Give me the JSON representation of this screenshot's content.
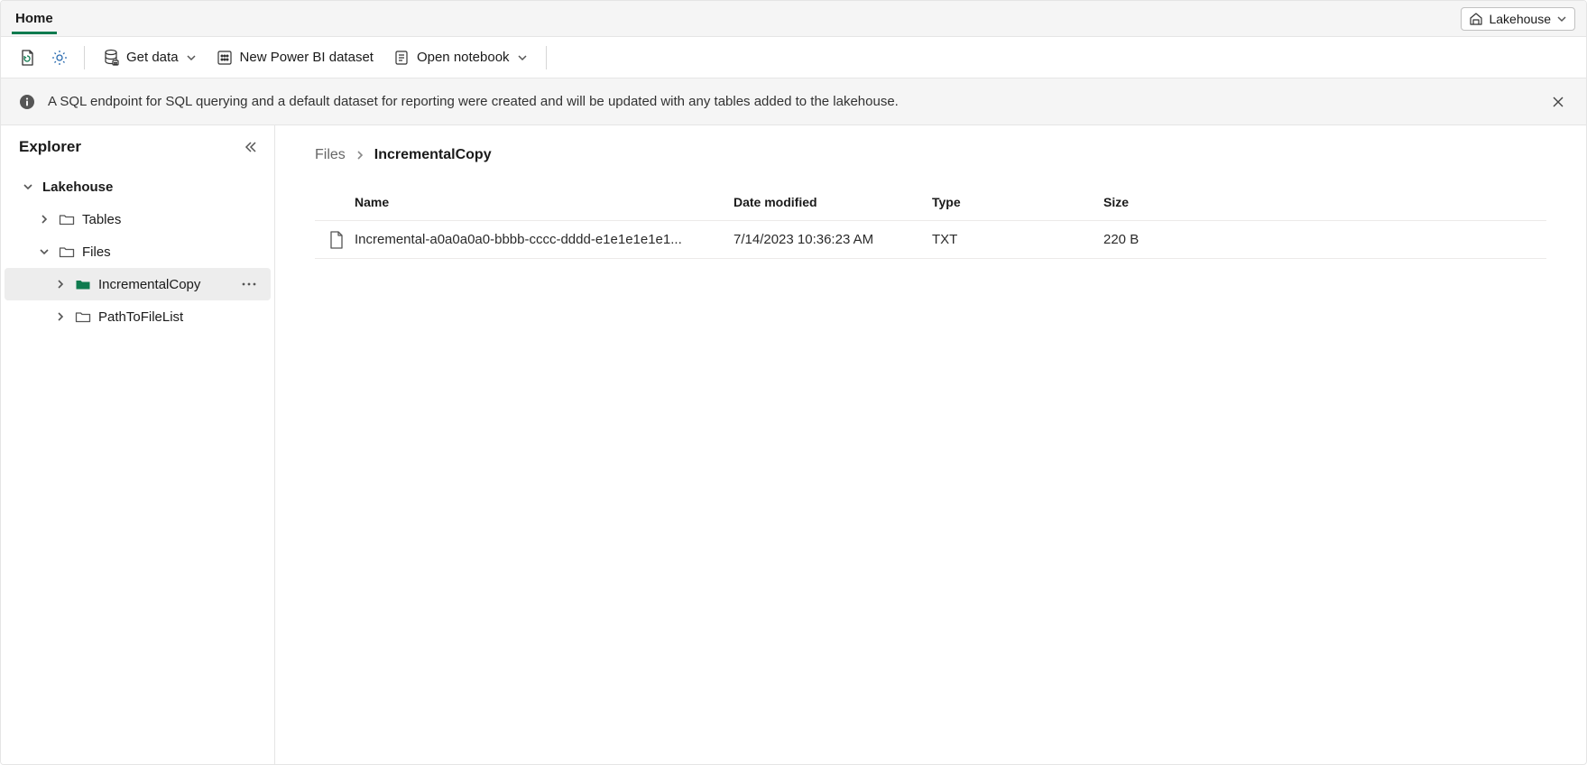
{
  "header": {
    "tab_home": "Home",
    "mode_label": "Lakehouse"
  },
  "toolbar": {
    "get_data_label": "Get data",
    "new_dataset_label": "New Power BI dataset",
    "open_notebook_label": "Open notebook"
  },
  "infobar": {
    "message": "A SQL endpoint for SQL querying and a default dataset for reporting were created and will be updated with any tables added to the lakehouse."
  },
  "explorer": {
    "title": "Explorer",
    "root_label": "Lakehouse",
    "items": {
      "tables": "Tables",
      "files": "Files",
      "incremental_copy": "IncrementalCopy",
      "path_to_file_list": "PathToFileList"
    }
  },
  "breadcrumb": {
    "parent": "Files",
    "current": "IncrementalCopy"
  },
  "table": {
    "columns": {
      "name": "Name",
      "date_modified": "Date modified",
      "type": "Type",
      "size": "Size"
    },
    "rows": [
      {
        "name": "Incremental-a0a0a0a0-bbbb-cccc-dddd-e1e1e1e1e1...",
        "date_modified": "7/14/2023 10:36:23 AM",
        "type": "TXT",
        "size": "220 B"
      }
    ]
  },
  "icons": {
    "folder_color": "#0f7b4f"
  }
}
